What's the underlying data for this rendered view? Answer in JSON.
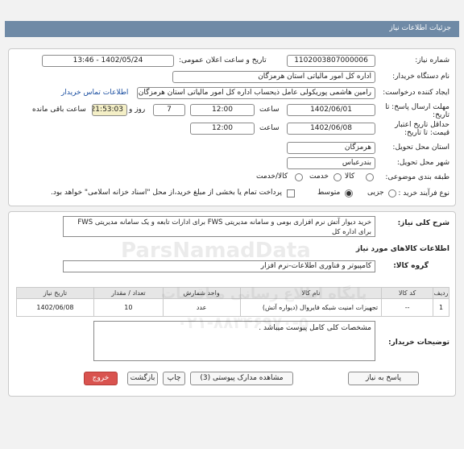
{
  "header": {
    "title": "جزئیات اطلاعات نیاز"
  },
  "form": {
    "need_number_label": "شماره نیاز:",
    "need_number": "1102003807000006",
    "announce_label": "تاریخ و ساعت اعلان عمومی:",
    "announce_value": "1402/05/24 - 13:46",
    "buyer_label": "نام دستگاه خریدار:",
    "buyer_value": "اداره کل امور مالیاتی استان هرمزگان",
    "creator_label": "ایجاد کننده درخواست:",
    "creator_value": "رامین هاشمی پوریکولی عامل ذیحساب اداره کل امور مالیاتی استان هرمزگان",
    "contact_link": "اطلاعات تماس خریدار",
    "deadline_label_1": "مهلت ارسال پاسخ: تا",
    "deadline_label_2": "تاریخ:",
    "deadline_date": "1402/06/01",
    "time_label": "ساعت",
    "deadline_time": "12:00",
    "days_value": "7",
    "days_label": "روز و",
    "remaining_time": "21:53:03",
    "remaining_label": "ساعت باقی مانده",
    "validity_label_1": "حداقل تاریخ اعتبار",
    "validity_label_2": "قیمت: تا تاریخ:",
    "validity_date": "1402/06/08",
    "validity_time_label": "ساعت",
    "validity_time": "12:00",
    "province_label": "استان محل تحویل:",
    "province_value": "هرمزگان",
    "city_label": "شهر محل تحویل:",
    "city_value": "بندرعباس",
    "category_label": "طبقه بندی موضوعی:",
    "category_options": [
      "کالا",
      "خدمت",
      "کالا/خدمت"
    ],
    "process_label": "نوع فرآیند خرید :",
    "process_options": [
      "جزیی",
      "متوسط"
    ],
    "payment_note": "پرداخت تمام یا بخشی از مبلغ خرید،از محل \"اسناد خزانه اسلامی\" خواهد بود."
  },
  "details": {
    "summary_label": "شرح کلی نیاز:",
    "summary_value": "خرید دیوار آتش نرم افزاری بومی و سامانه مدیریتی FWS برای ادارات تابعه و یک سامانه مدیریتی FWS برای اداره کل",
    "goods_title": "اطلاعات کالاهای مورد نیاز",
    "group_label": "گروه کالا:",
    "group_value": "کامپیوتر و فناوری اطلاعات-نرم افزار",
    "table": {
      "headers": [
        "ردیف",
        "کد کالا",
        "نام کالا",
        "واحد شمارش",
        "تعداد / مقدار",
        "تاریخ نیاز"
      ],
      "rows": [
        [
          "1",
          "--",
          "تجهیزات امنیت شبکه فایروال (دیواره آتش)",
          "عدد",
          "10",
          "1402/06/08"
        ]
      ]
    },
    "buyer_notes_label": "توضیحات خریدار:",
    "buyer_notes_value": "مشخصات کلی کامل پیوست میباشد ."
  },
  "buttons": {
    "reply": "پاسخ به نیاز",
    "docs": "مشاهده مدارک پیوستی (3)",
    "print": "چاپ",
    "back": "بازگشت",
    "exit": "خروج"
  },
  "watermark": {
    "brand": "ParsNamadData",
    "line1": "پایگاه اطلاع رسانی مناقصات",
    "phone": "۰۲۱-۸۸۳۴۶۹۷۰-۵"
  },
  "colors": {
    "header": "#6f8aa6",
    "exit_button": "#d9534f",
    "remaining_bg": "#f4efc6"
  }
}
